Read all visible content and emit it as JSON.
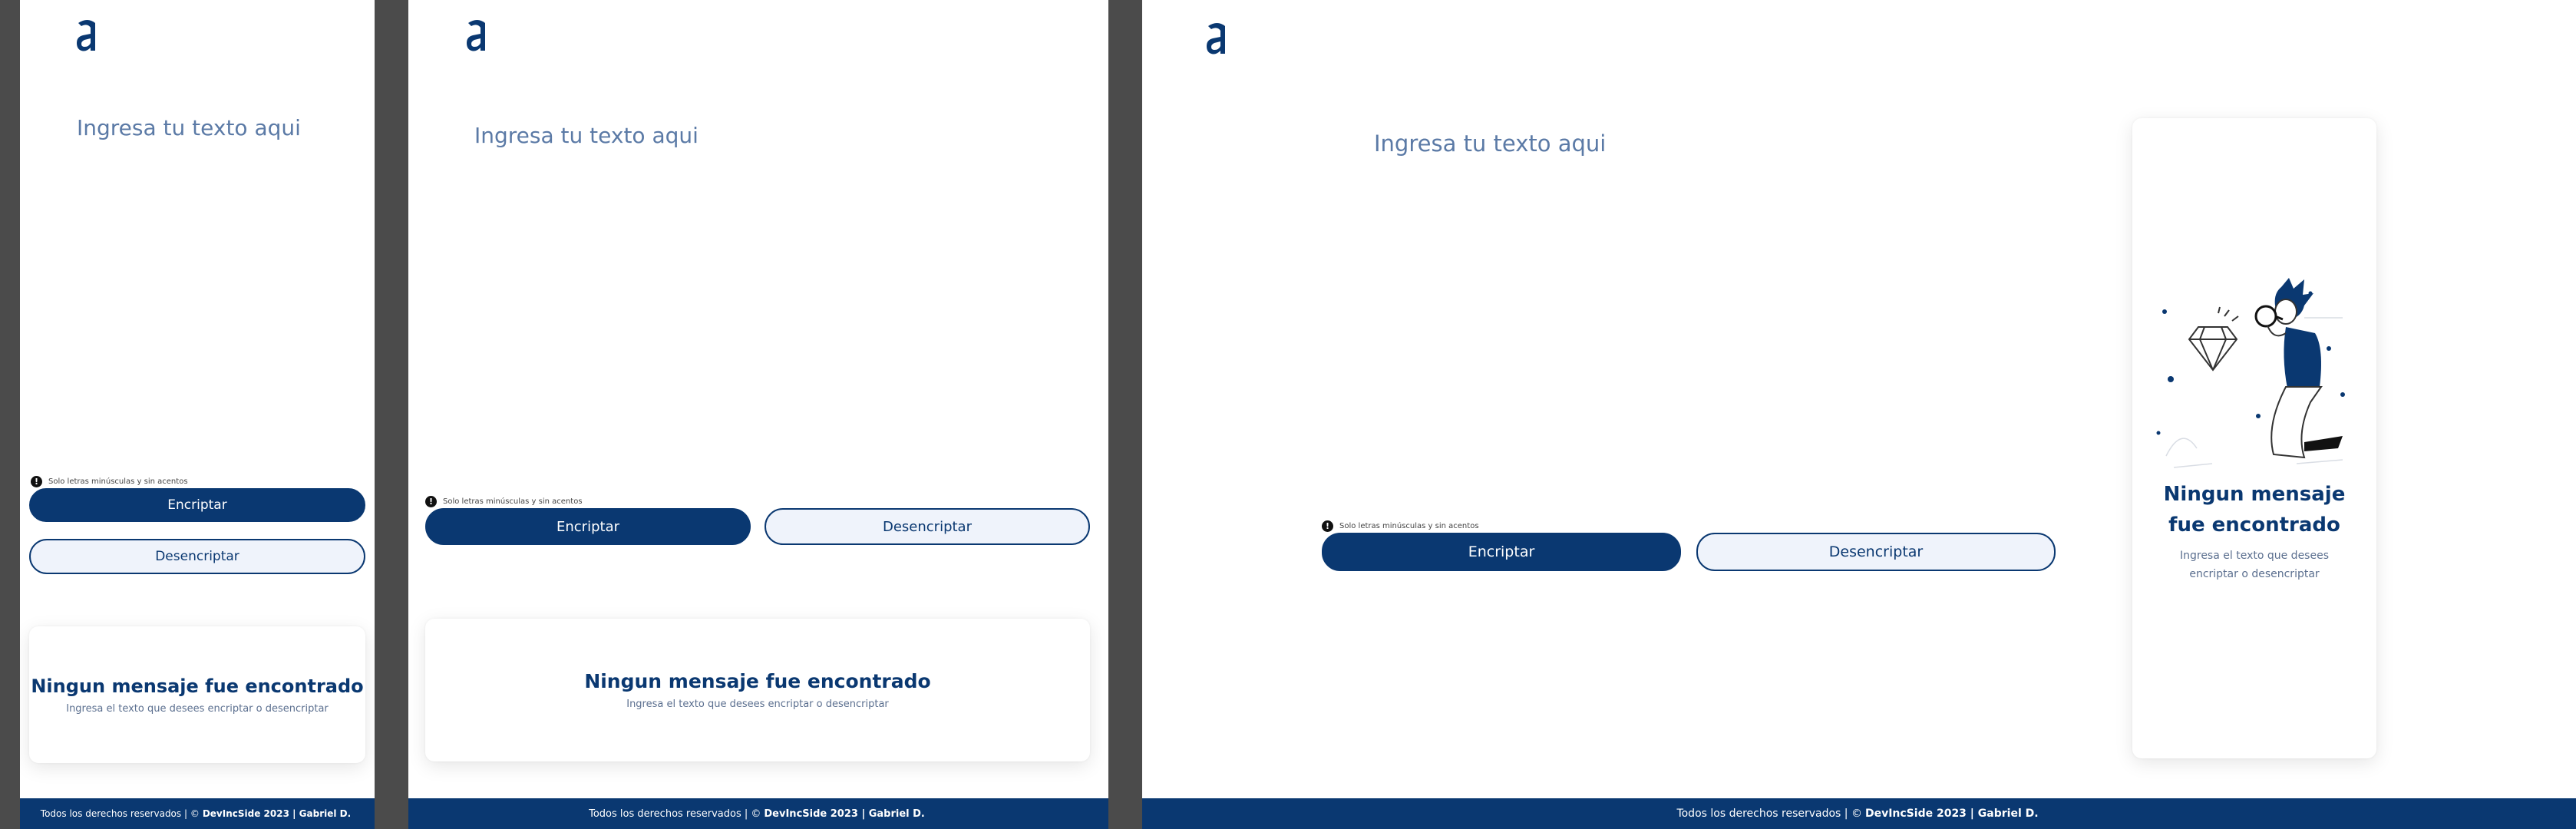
{
  "placeholder": "Ingresa tu texto aqui",
  "warning": "Solo letras minúsculas y sin acentos",
  "warning_icon": "info-icon",
  "buttons": {
    "encrypt": "Encriptar",
    "decrypt": "Desencriptar"
  },
  "empty_state": {
    "title": "Ningun mensaje fue encontrado",
    "subtitle": "Ingresa el texto que desees encriptar o desencriptar",
    "illustration": "person-with-magnifying-glass-looking-at-diamond"
  },
  "footer": {
    "prefix": "Todos los derechos reservados | ©",
    "brand": "DevIncSide 2023 | Gabriel D."
  },
  "colors": {
    "primary": "#0a3871",
    "secondary_bg": "#eff3fb",
    "placeholder": "#5b7aa6",
    "background_gutter": "#4b4b4b"
  }
}
